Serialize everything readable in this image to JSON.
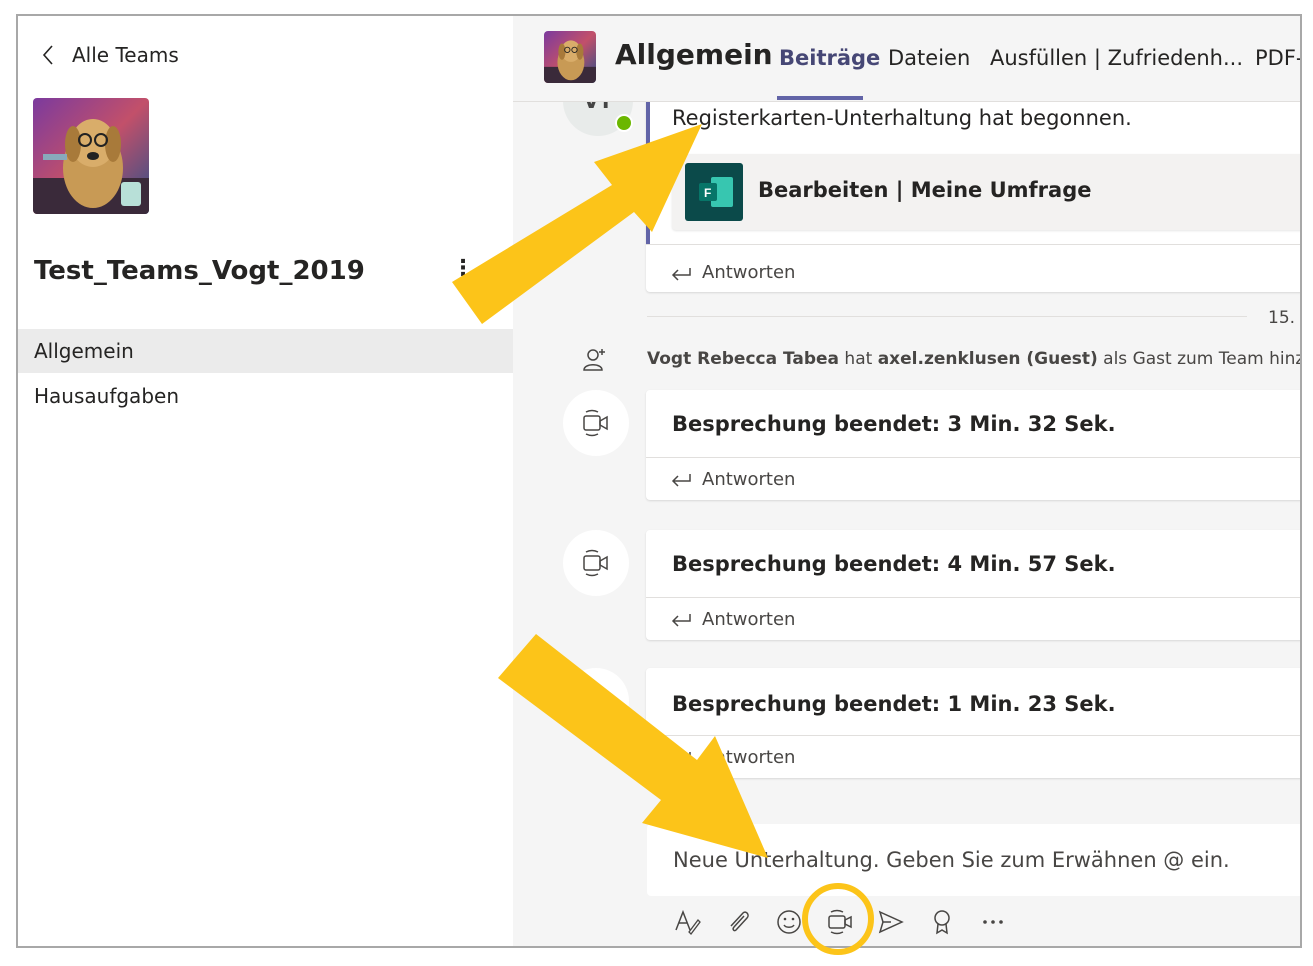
{
  "sidebar": {
    "back_label": "Alle Teams",
    "team_name": "Test_Teams_Vogt_2019",
    "more_label": "⋮",
    "channels": [
      {
        "label": "Allgemein",
        "active": true
      },
      {
        "label": "Hausaufgaben",
        "active": false
      }
    ]
  },
  "header": {
    "channel_title": "Allgemein",
    "tabs": [
      {
        "label": "Beiträge",
        "active": true
      },
      {
        "label": "Dateien",
        "active": false
      },
      {
        "label": "Ausfüllen | Zufriedenh...",
        "active": false
      },
      {
        "label": "PDF-",
        "active": false
      }
    ]
  },
  "feed": {
    "first_post": {
      "avatar_initials": "VT",
      "text": "Registerkarten-Unterhaltung hat begonnen.",
      "attachment_title": "Bearbeiten | Meine Umfrage",
      "reply_label": "Antworten"
    },
    "date_label": "15.",
    "system_message": {
      "user": "Vogt Rebecca Tabea",
      "middle": " hat ",
      "guest": "axel.zenklusen (Guest)",
      "tail": " als Gast zum Team hinzugefü"
    },
    "meetings": [
      {
        "title": "Besprechung beendet: 3 Min. 32 Sek.",
        "reply_label": "Antworten"
      },
      {
        "title": "Besprechung beendet: 4 Min. 57 Sek.",
        "reply_label": "Antworten"
      },
      {
        "title": "Besprechung beendet: 1 Min. 23 Sek.",
        "reply_label": "Antworten"
      }
    ]
  },
  "compose": {
    "placeholder": "Neue Unterhaltung. Geben Sie zum Erwähnen @ ein."
  },
  "toolbar": {
    "icons": [
      "format-icon",
      "attach-icon",
      "emoji-icon",
      "meet-now-icon",
      "send-icon",
      "praise-icon",
      "more-icon"
    ]
  },
  "colors": {
    "accent": "#6264a7",
    "highlight": "#fcc419",
    "presence": "#6bb700",
    "forms": "#077568"
  }
}
